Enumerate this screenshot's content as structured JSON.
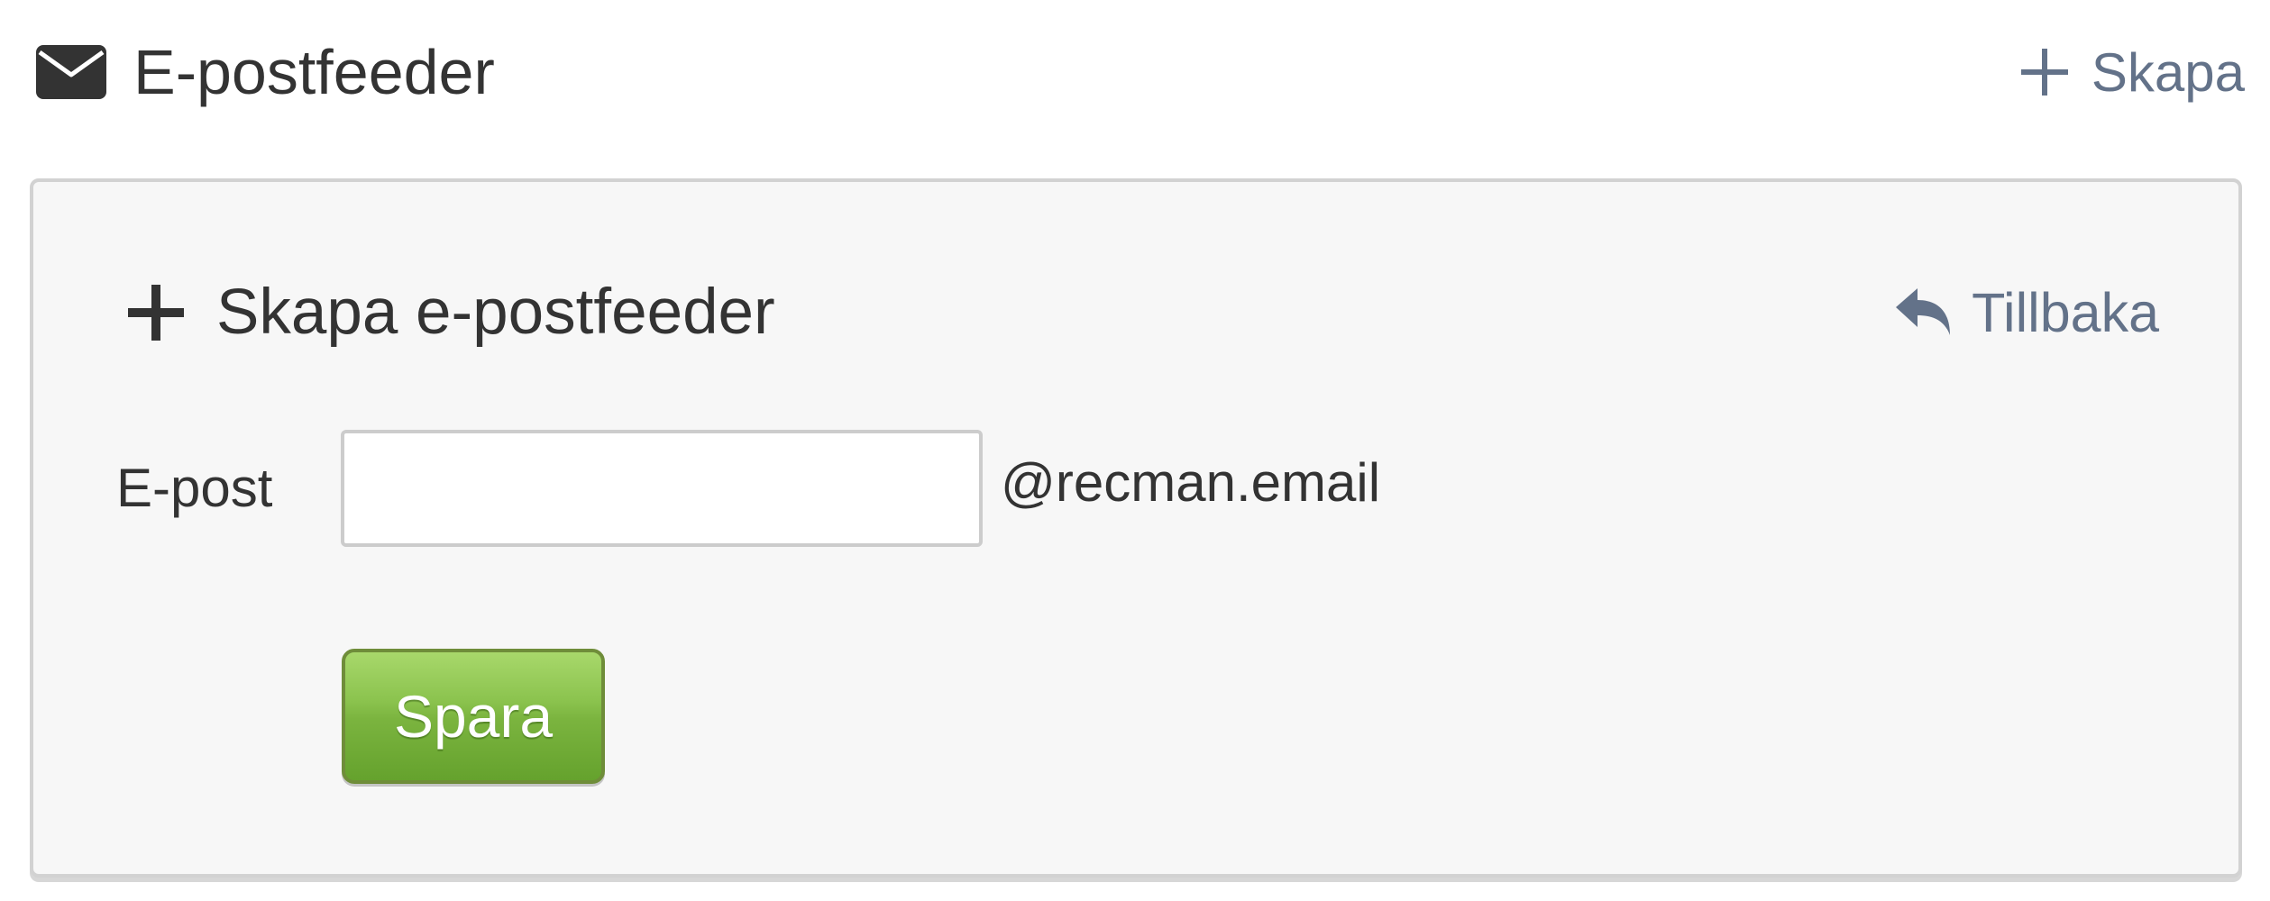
{
  "colors": {
    "text": "#333333",
    "link": "#637289",
    "panel_background": "#f7f7f7",
    "panel_border": "#d2d2d2",
    "save_button_green": "#7bb43f"
  },
  "header": {
    "icon": "envelope-icon",
    "title": "E-postfeeder",
    "create_icon": "plus-icon",
    "create_label": "Skapa"
  },
  "panel": {
    "icon": "plus-icon",
    "title": "Skapa e-postfeeder",
    "back_icon": "reply-arrow-icon",
    "back_label": "Tillbaka",
    "form": {
      "email_label": "E-post",
      "email_value": "",
      "email_placeholder": "",
      "email_suffix": "@recman.email",
      "save_label": "Spara"
    }
  }
}
